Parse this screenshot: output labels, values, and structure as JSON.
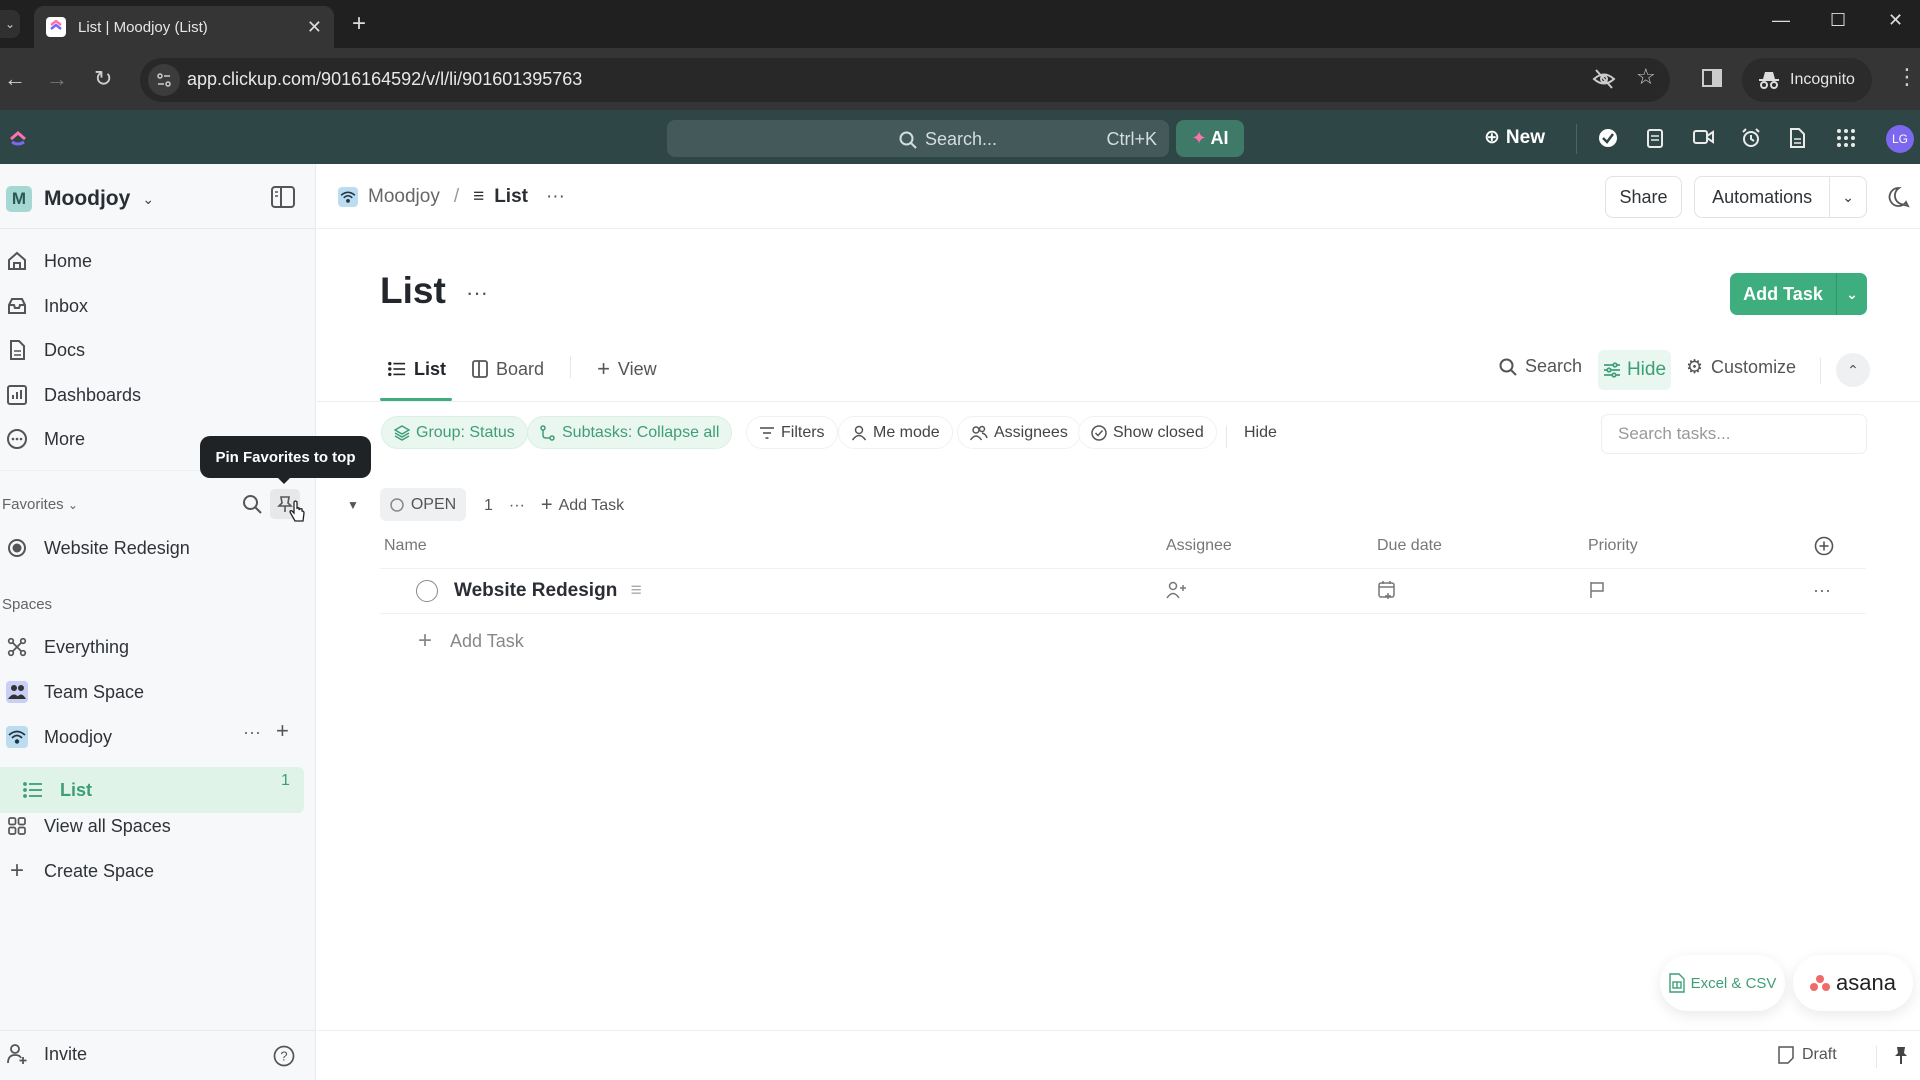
{
  "browser": {
    "tab_title": "List | Moodjoy (List)",
    "url": "app.clickup.com/9016164592/v/l/li/901601395763",
    "profile_label": "Incognito"
  },
  "topbar": {
    "search_placeholder": "Search...",
    "search_shortcut": "Ctrl+K",
    "ai_label": "AI",
    "new_label": "New",
    "avatar_initials": "LG",
    "icons": [
      "check-circle-icon",
      "notepad-icon",
      "video-icon",
      "alarm-icon",
      "doc-icon",
      "apps-grid-icon"
    ]
  },
  "sidebar": {
    "workspace": {
      "initial": "M",
      "name": "Moodjoy"
    },
    "nav": [
      {
        "label": "Home",
        "icon": "home-icon"
      },
      {
        "label": "Inbox",
        "icon": "inbox-icon"
      },
      {
        "label": "Docs",
        "icon": "docs-icon"
      },
      {
        "label": "Dashboards",
        "icon": "dashboard-icon"
      },
      {
        "label": "More",
        "icon": "more-icon"
      }
    ],
    "favorites_label": "Favorites",
    "favorites": [
      {
        "label": "Website Redesign"
      }
    ],
    "tooltip": "Pin Favorites to top",
    "spaces_label": "Spaces",
    "spaces": [
      {
        "label": "Everything"
      },
      {
        "label": "Team Space"
      },
      {
        "label": "Moodjoy"
      }
    ],
    "active_list": {
      "label": "List",
      "count": "1"
    },
    "view_all_spaces": "View all Spaces",
    "create_space": "Create Space",
    "invite": "Invite"
  },
  "header": {
    "breadcrumb": [
      {
        "label": "Moodjoy"
      },
      {
        "label": "List"
      }
    ],
    "share_label": "Share",
    "automations_label": "Automations"
  },
  "main": {
    "title": "List",
    "add_task_label": "Add Task",
    "view_tabs": [
      {
        "label": "List",
        "active": true
      },
      {
        "label": "Board",
        "active": false
      },
      {
        "label": "View",
        "active": false
      }
    ],
    "tools": {
      "search": "Search",
      "hide": "Hide",
      "customize": "Customize"
    },
    "chips": [
      {
        "label": "Group: Status"
      },
      {
        "label": "Subtasks: Collapse all"
      },
      {
        "label": "Filters"
      },
      {
        "label": "Me mode"
      },
      {
        "label": "Assignees"
      },
      {
        "label": "Show closed"
      },
      {
        "label": "Hide"
      }
    ],
    "search_tasks_placeholder": "Search tasks...",
    "group": {
      "status": "OPEN",
      "count": "1",
      "add_task": "Add Task"
    },
    "columns": [
      "Name",
      "Assignee",
      "Due date",
      "Priority"
    ],
    "tasks": [
      {
        "name": "Website Redesign"
      }
    ],
    "add_task_row": "Add Task"
  },
  "footer": {
    "import_excel": "Excel & CSV",
    "import_asana": "asana",
    "draft": "Draft"
  },
  "colors": {
    "brand_green": "#3fae7e",
    "topbar": "#2e4645",
    "accent_purple": "#7b68ee"
  }
}
